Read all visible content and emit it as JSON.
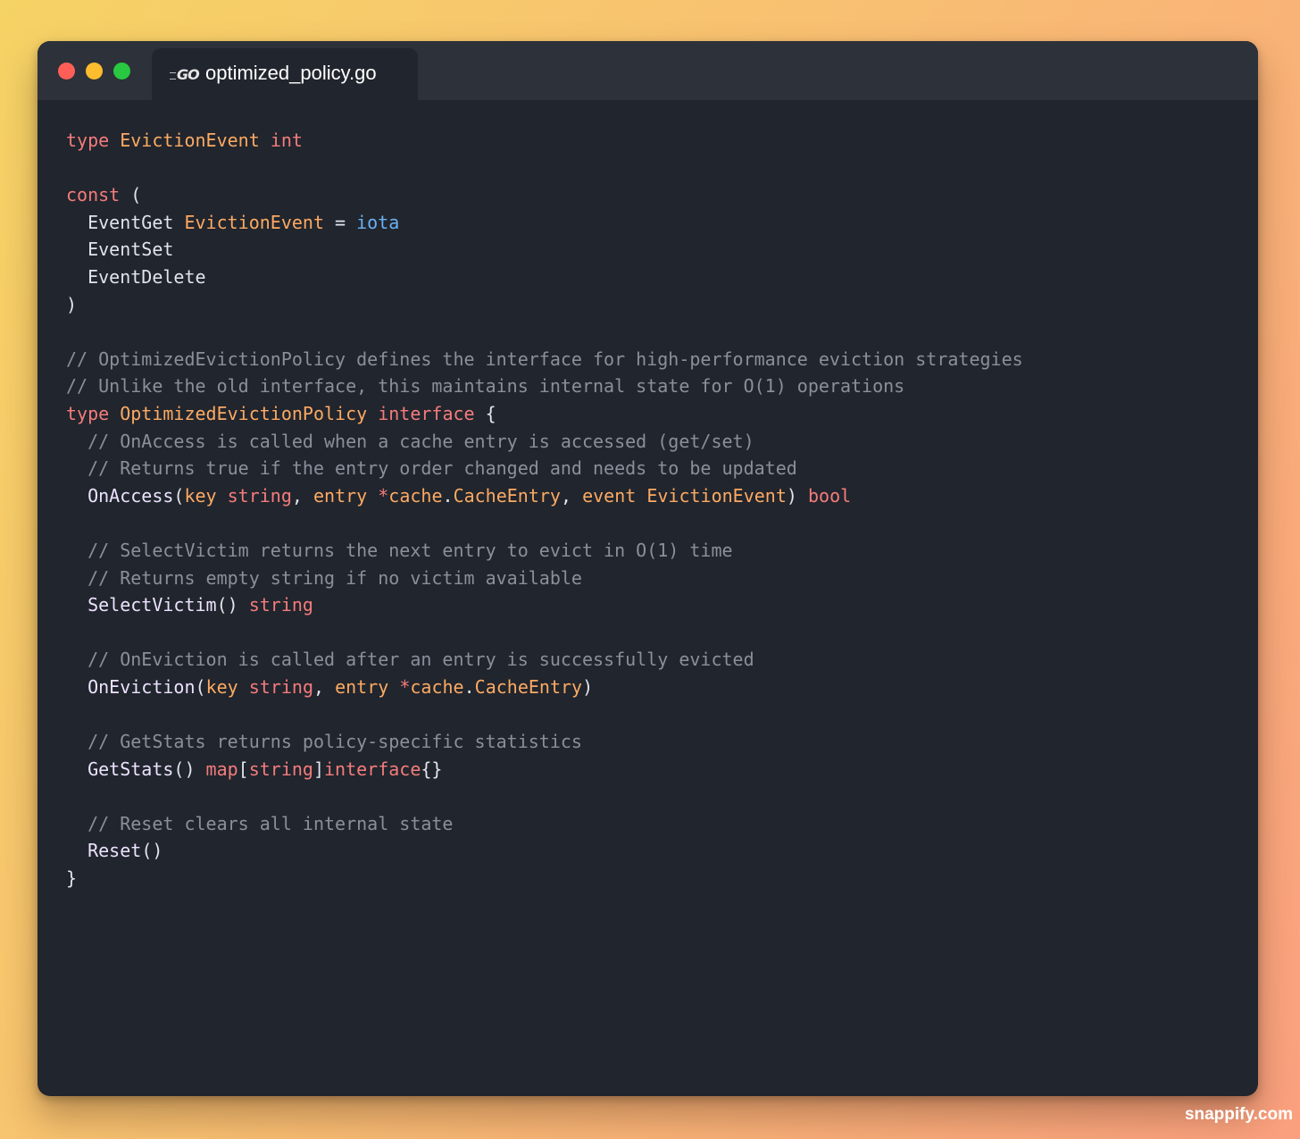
{
  "window": {
    "controls": [
      "close",
      "minimize",
      "maximize"
    ],
    "tab": {
      "icon": "go-language-icon",
      "title": "optimized_policy.go"
    }
  },
  "code": {
    "language": "go",
    "lines": [
      [
        [
          "kw",
          "type"
        ],
        [
          "pn",
          " "
        ],
        [
          "ty",
          "EvictionEvent"
        ],
        [
          "pn",
          " "
        ],
        [
          "kw",
          "int"
        ]
      ],
      [],
      [
        [
          "kw",
          "const"
        ],
        [
          "pn",
          " ("
        ]
      ],
      [
        [
          "pn",
          "  EventGet "
        ],
        [
          "ty",
          "EvictionEvent"
        ],
        [
          "pn",
          " = "
        ],
        [
          "num",
          "iota"
        ]
      ],
      [
        [
          "pn",
          "  EventSet"
        ]
      ],
      [
        [
          "pn",
          "  EventDelete"
        ]
      ],
      [
        [
          "pn",
          ")"
        ]
      ],
      [],
      [
        [
          "cm",
          "// OptimizedEvictionPolicy defines the interface for high-performance eviction strategies"
        ]
      ],
      [
        [
          "cm",
          "// Unlike the old interface, this maintains internal state for O(1) operations"
        ]
      ],
      [
        [
          "kw",
          "type"
        ],
        [
          "pn",
          " "
        ],
        [
          "ty",
          "OptimizedEvictionPolicy"
        ],
        [
          "pn",
          " "
        ],
        [
          "kw",
          "interface"
        ],
        [
          "pn",
          " {"
        ]
      ],
      [
        [
          "cm",
          "  // OnAccess is called when a cache entry is accessed (get/set)"
        ]
      ],
      [
        [
          "cm",
          "  // Returns true if the entry order changed and needs to be updated"
        ]
      ],
      [
        [
          "pn",
          "  "
        ],
        [
          "fn",
          "OnAccess"
        ],
        [
          "pn",
          "("
        ],
        [
          "ty",
          "key"
        ],
        [
          "pn",
          " "
        ],
        [
          "kw",
          "string"
        ],
        [
          "pn",
          ", "
        ],
        [
          "ty",
          "entry"
        ],
        [
          "pn",
          " "
        ],
        [
          "kw",
          "*"
        ],
        [
          "ty",
          "cache"
        ],
        [
          "pn",
          "."
        ],
        [
          "ty",
          "CacheEntry"
        ],
        [
          "pn",
          ", "
        ],
        [
          "ty",
          "event"
        ],
        [
          "pn",
          " "
        ],
        [
          "ty",
          "EvictionEvent"
        ],
        [
          "pn",
          ") "
        ],
        [
          "kw",
          "bool"
        ]
      ],
      [],
      [
        [
          "cm",
          "  // SelectVictim returns the next entry to evict in O(1) time"
        ]
      ],
      [
        [
          "cm",
          "  // Returns empty string if no victim available"
        ]
      ],
      [
        [
          "pn",
          "  "
        ],
        [
          "fn",
          "SelectVictim"
        ],
        [
          "pn",
          "() "
        ],
        [
          "kw",
          "string"
        ]
      ],
      [],
      [
        [
          "cm",
          "  // OnEviction is called after an entry is successfully evicted"
        ]
      ],
      [
        [
          "pn",
          "  "
        ],
        [
          "fn",
          "OnEviction"
        ],
        [
          "pn",
          "("
        ],
        [
          "ty",
          "key"
        ],
        [
          "pn",
          " "
        ],
        [
          "kw",
          "string"
        ],
        [
          "pn",
          ", "
        ],
        [
          "ty",
          "entry"
        ],
        [
          "pn",
          " "
        ],
        [
          "kw",
          "*"
        ],
        [
          "ty",
          "cache"
        ],
        [
          "pn",
          "."
        ],
        [
          "ty",
          "CacheEntry"
        ],
        [
          "pn",
          ")"
        ]
      ],
      [],
      [
        [
          "cm",
          "  // GetStats returns policy-specific statistics"
        ]
      ],
      [
        [
          "pn",
          "  "
        ],
        [
          "fn",
          "GetStats"
        ],
        [
          "pn",
          "() "
        ],
        [
          "kw",
          "map"
        ],
        [
          "pn",
          "["
        ],
        [
          "kw",
          "string"
        ],
        [
          "pn",
          "]"
        ],
        [
          "kw",
          "interface"
        ],
        [
          "pn",
          "{}"
        ]
      ],
      [],
      [
        [
          "cm",
          "  // Reset clears all internal state"
        ]
      ],
      [
        [
          "pn",
          "  "
        ],
        [
          "fn",
          "Reset"
        ],
        [
          "pn",
          "()"
        ]
      ],
      [
        [
          "pn",
          "}"
        ]
      ]
    ]
  },
  "watermark": "snappify.com",
  "colors": {
    "keyword": "#f47c7c",
    "type": "#fcaa63",
    "constant": "#6ab0f3",
    "comment": "#8a909b",
    "function": "#ece3ff",
    "plain": "#e1e4ea",
    "editor_background": "#21252d"
  }
}
